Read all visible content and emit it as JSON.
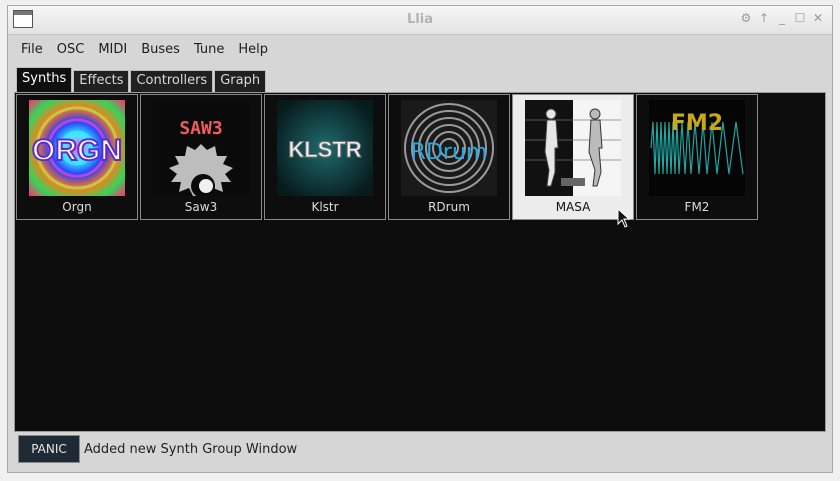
{
  "window": {
    "title": "Llia"
  },
  "menu": [
    "File",
    "OSC",
    "MIDI",
    "Buses",
    "Tune",
    "Help"
  ],
  "tabs": [
    "Synths",
    "Effects",
    "Controllers",
    "Graph"
  ],
  "active_tab": "Synths",
  "synths": [
    {
      "name": "Orgn",
      "logo_text": "ORGN"
    },
    {
      "name": "Saw3",
      "logo_text": "SAW3"
    },
    {
      "name": "Klstr",
      "logo_text": "KLSTR"
    },
    {
      "name": "RDrum",
      "logo_text": "RDrum"
    },
    {
      "name": "MASA",
      "logo_text": ""
    },
    {
      "name": "FM2",
      "logo_text": "FM2"
    }
  ],
  "selected_synth": "MASA",
  "status": {
    "panic_label": "PANIC",
    "message": "Added new Synth Group Window"
  },
  "colors": {
    "panel_bg": "#0d0d0d",
    "chrome_bg": "#d6d6d6",
    "rdrum_text": "#29a9e1",
    "fm2_text": "#c9a915",
    "fm2_wave": "#1fa6a1",
    "saw3_text": "#f25c5c"
  }
}
